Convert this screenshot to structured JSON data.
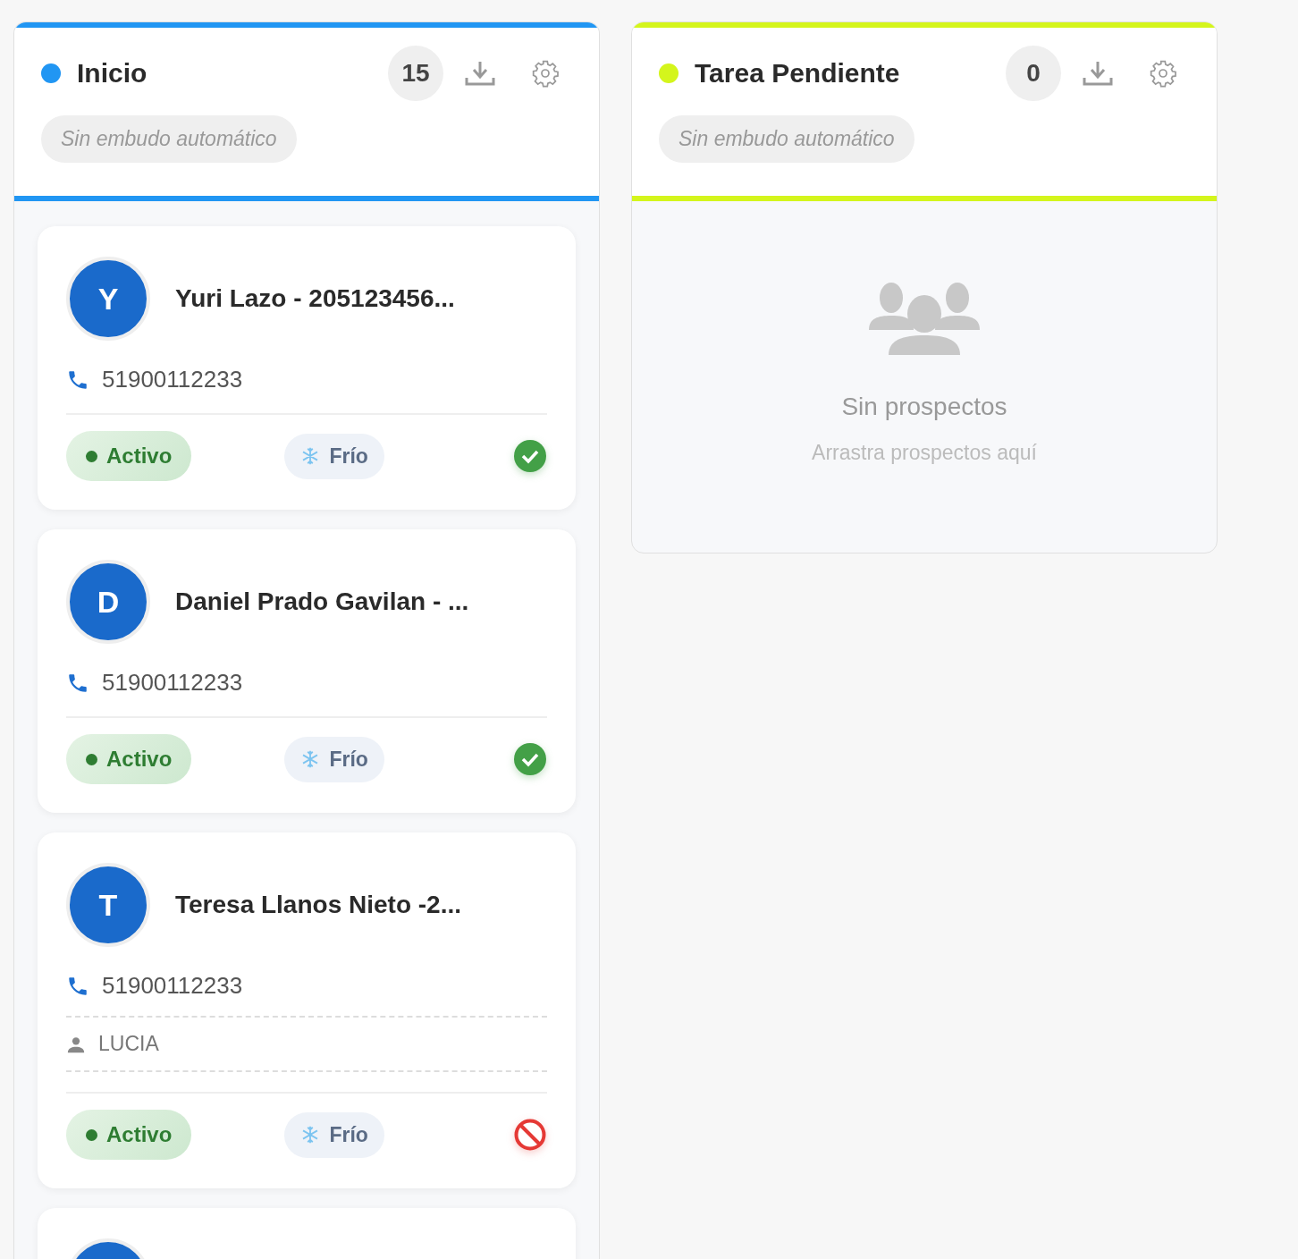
{
  "columns": [
    {
      "title": "Inicio",
      "color": "#2196f3",
      "count": "15",
      "funnel": "Sin embudo automático",
      "more_below": true,
      "leads": [
        {
          "initial": "Y",
          "name": "Yuri Lazo - 205123456...",
          "phone": "51900112233",
          "status": "Activo",
          "temperature": "Frío",
          "valid": true
        },
        {
          "initial": "D",
          "name": "Daniel Prado Gavilan - ...",
          "phone": "51900112233",
          "status": "Activo",
          "temperature": "Frío",
          "valid": true
        },
        {
          "initial": "T",
          "name": "Teresa Llanos Nieto -2...",
          "phone": "51900112233",
          "agent": "LUCIA",
          "status": "Activo",
          "temperature": "Frío",
          "valid": false
        }
      ]
    },
    {
      "title": "Tarea Pendiente",
      "color": "#d4f51c",
      "count": "0",
      "funnel": "Sin embudo automático",
      "more_below": false,
      "empty": {
        "title": "Sin prospectos",
        "hint": "Arrastra prospectos aquí"
      }
    }
  ]
}
